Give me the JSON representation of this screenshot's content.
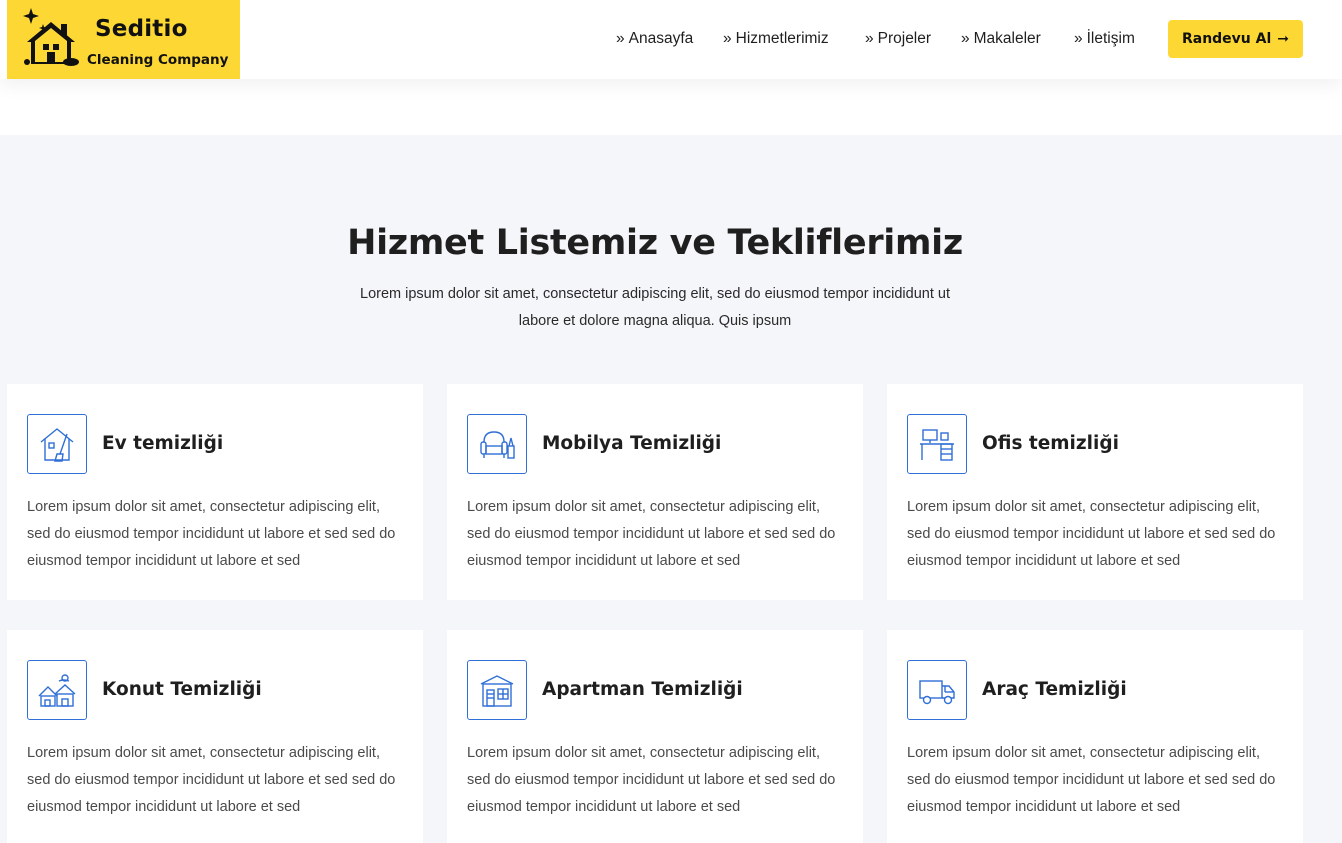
{
  "brand": {
    "name": "Seditio",
    "tagline": "Cleaning Company",
    "color": "#fdd835"
  },
  "nav": {
    "items": [
      {
        "label": "Anasayfa",
        "prefix": "»"
      },
      {
        "label": "Hizmetlerimiz",
        "prefix": "»"
      },
      {
        "label": "Projeler",
        "prefix": "»"
      },
      {
        "label": "Makaleler",
        "prefix": "»"
      },
      {
        "label": "İletişim",
        "prefix": "»"
      }
    ],
    "cta_label": "Randevu Al",
    "cta_arrow": "➞"
  },
  "services": {
    "title": "Hizmet Listemiz ve Tekliflerimiz",
    "description": "Lorem ipsum dolor sit amet, consectetur adipiscing elit, sed do eiusmod tempor incididunt ut labore et dolore magna aliqua. Quis ipsum",
    "accent": "#2f6fd6",
    "cards": [
      {
        "title": "Ev temizliği",
        "icon": "house-cleaning-icon",
        "text": "Lorem ipsum dolor sit amet, consectetur adipiscing elit, sed do eiusmod tempor incididunt ut labore et sed sed do eiusmod tempor incididunt ut labore et sed"
      },
      {
        "title": "Mobilya Temizliği",
        "icon": "armchair-icon",
        "text": "Lorem ipsum dolor sit amet, consectetur adipiscing elit, sed do eiusmod tempor incididunt ut labore et sed sed do eiusmod tempor incididunt ut labore et sed"
      },
      {
        "title": "Ofis temizliği",
        "icon": "office-desk-icon",
        "text": "Lorem ipsum dolor sit amet, consectetur adipiscing elit, sed do eiusmod tempor incididunt ut labore et sed sed do eiusmod tempor incididunt ut labore et sed"
      },
      {
        "title": "Konut Temizliği",
        "icon": "houses-icon",
        "text": "Lorem ipsum dolor sit amet, consectetur adipiscing elit, sed do eiusmod tempor incididunt ut labore et sed sed do eiusmod tempor incididunt ut labore et sed"
      },
      {
        "title": "Apartman Temizliği",
        "icon": "apartment-icon",
        "text": "Lorem ipsum dolor sit amet, consectetur adipiscing elit, sed do eiusmod tempor incididunt ut labore et sed sed do eiusmod tempor incididunt ut labore et sed"
      },
      {
        "title": "Araç Temizliği",
        "icon": "truck-icon",
        "text": "Lorem ipsum dolor sit amet, consectetur adipiscing elit, sed do eiusmod tempor incididunt ut labore et sed sed do eiusmod tempor incididunt ut labore et sed"
      }
    ]
  }
}
